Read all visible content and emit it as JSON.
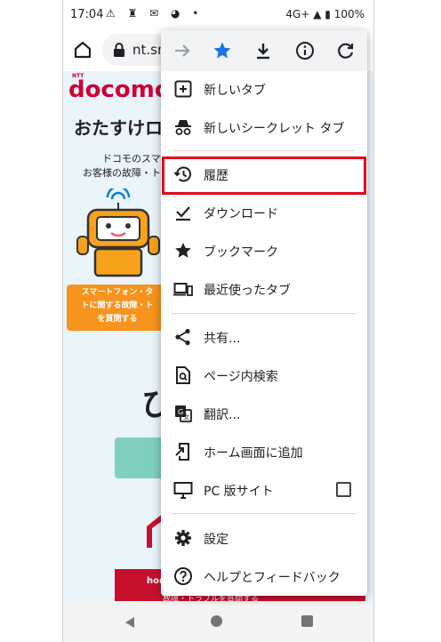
{
  "status_bar": {
    "time": "17:04",
    "network": "4G+",
    "battery": "100%"
  },
  "browser": {
    "url": "nt.sm"
  },
  "page": {
    "ntt": "NTT",
    "logo": "docomo",
    "title": "おたすけロ",
    "subtitle_line1": "ドコモのスマー",
    "subtitle_line2": "お客様の故障・ト",
    "orange_box_line1": "スマートフォン・タ",
    "orange_box_line2": "トに関する故障・ト",
    "orange_box_line3": "を質問する",
    "big_char": "ひ",
    "red_banner": "hor",
    "red_banner_line2": "故障・トラブルを質問する"
  },
  "menu": {
    "items": [
      {
        "label": "新しいタブ",
        "icon": "new-tab-icon"
      },
      {
        "label": "新しいシークレット タブ",
        "icon": "incognito-icon"
      },
      {
        "label": "履歴",
        "icon": "history-icon"
      },
      {
        "label": "ダウンロード",
        "icon": "downloads-icon"
      },
      {
        "label": "ブックマーク",
        "icon": "bookmark-star-icon"
      },
      {
        "label": "最近使ったタブ",
        "icon": "recent-tabs-icon"
      },
      {
        "label": "共有...",
        "icon": "share-icon"
      },
      {
        "label": "ページ内検索",
        "icon": "find-in-page-icon"
      },
      {
        "label": "翻訳...",
        "icon": "translate-icon"
      },
      {
        "label": "ホーム画面に追加",
        "icon": "add-to-home-icon"
      },
      {
        "label": "PC 版サイト",
        "icon": "desktop-icon"
      },
      {
        "label": "設定",
        "icon": "settings-gear-icon"
      },
      {
        "label": "ヘルプとフィードバック",
        "icon": "help-icon"
      }
    ]
  },
  "colors": {
    "accent_star": "#1a73e8",
    "highlight": "#e0081e",
    "docomo_red": "#cc0033"
  }
}
